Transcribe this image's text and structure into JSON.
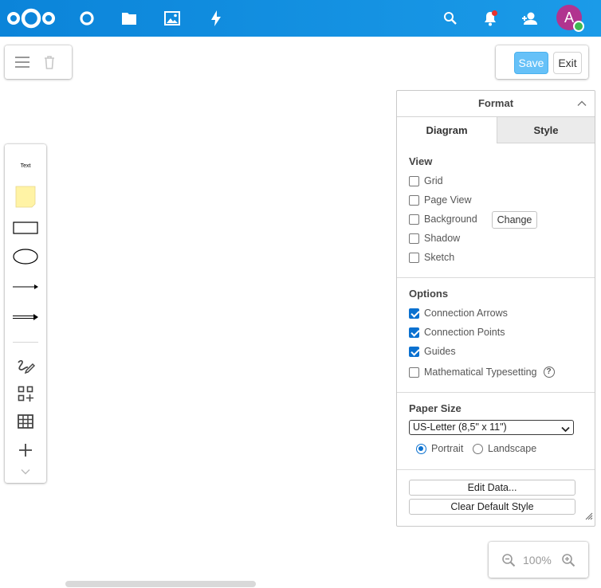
{
  "topbar": {
    "brand_color": "#0b84d9",
    "apps": [
      "nextcloud-logo-icon",
      "dashboard-icon",
      "files-icon",
      "photos-icon",
      "activity-icon"
    ],
    "right_icons": [
      "search-icon",
      "bell-icon",
      "contacts-icon"
    ],
    "notification_dot_color": "#e9322d",
    "avatar": {
      "initial": "A",
      "color": "#b1348f",
      "status_color": "#3fb950"
    }
  },
  "toolbar": {
    "left_icons": [
      "menu-icon",
      "trash-icon"
    ],
    "save_label": "Save",
    "exit_label": "Exit"
  },
  "shapes": {
    "text_label": "Text",
    "items": [
      "text-shape",
      "sticky-note-shape",
      "rectangle-shape",
      "ellipse-shape",
      "line-arrow-shape",
      "double-arrow-shape",
      "freehand-icon",
      "add-shapes-icon",
      "table-icon",
      "plus-icon",
      "chevron-down-icon"
    ]
  },
  "format": {
    "title": "Format",
    "tabs": [
      "Diagram",
      "Style"
    ],
    "active_tab": "Diagram",
    "view": {
      "title": "View",
      "items": [
        {
          "label": "Grid",
          "checked": false
        },
        {
          "label": "Page View",
          "checked": false
        },
        {
          "label": "Background",
          "checked": false
        },
        {
          "label": "Shadow",
          "checked": false
        },
        {
          "label": "Sketch",
          "checked": false
        }
      ],
      "change_label": "Change"
    },
    "options": {
      "title": "Options",
      "items": [
        {
          "label": "Connection Arrows",
          "checked": true
        },
        {
          "label": "Connection Points",
          "checked": true
        },
        {
          "label": "Guides",
          "checked": true
        },
        {
          "label": "Mathematical Typesetting",
          "checked": false
        }
      ],
      "help_glyph": "?"
    },
    "paper": {
      "title": "Paper Size",
      "selected": "US-Letter (8,5\" x 11\")",
      "orientation": [
        {
          "label": "Portrait",
          "selected": true
        },
        {
          "label": "Landscape",
          "selected": false
        }
      ]
    },
    "edit_data_label": "Edit Data...",
    "clear_style_label": "Clear Default Style"
  },
  "zoom": {
    "level": "100%"
  }
}
